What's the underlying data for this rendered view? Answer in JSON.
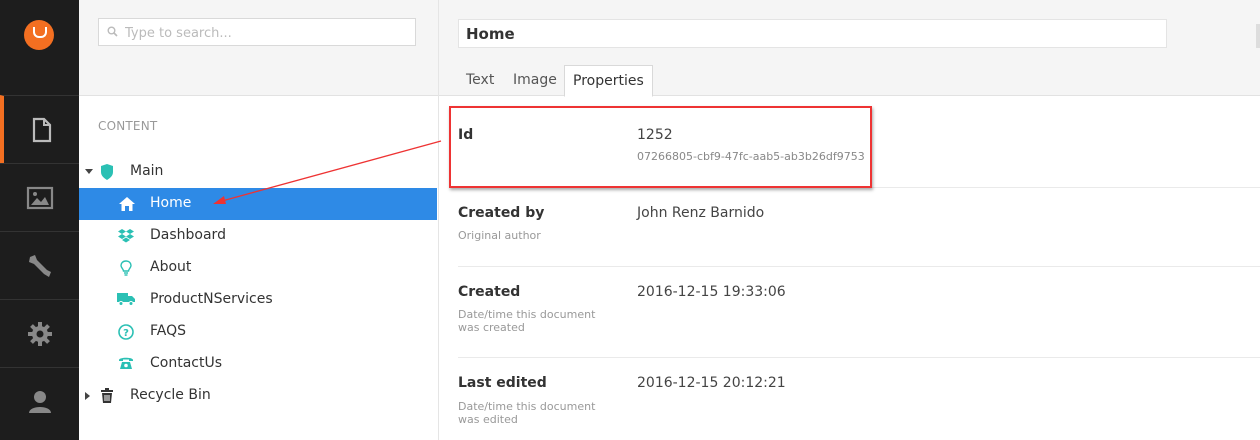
{
  "rail": {
    "logo": "umbraco-logo",
    "sections": [
      {
        "name": "content",
        "icon": "document-icon",
        "active": true
      },
      {
        "name": "media",
        "icon": "image-icon",
        "active": false
      },
      {
        "name": "developer",
        "icon": "wrench-icon",
        "active": false
      },
      {
        "name": "settings",
        "icon": "gear-icon",
        "active": false
      },
      {
        "name": "users",
        "icon": "user-icon",
        "active": false
      }
    ],
    "accent_color": "#f36f21"
  },
  "tree": {
    "search_placeholder": "Type to search...",
    "section_title": "CONTENT",
    "root": "Main",
    "items": [
      {
        "label": "Home",
        "icon": "home-icon",
        "selected": true
      },
      {
        "label": "Dashboard",
        "icon": "dropbox-icon"
      },
      {
        "label": "About",
        "icon": "lightbulb-icon"
      },
      {
        "label": "ProductNServices",
        "icon": "truck-icon"
      },
      {
        "label": "FAQS",
        "icon": "question-icon"
      },
      {
        "label": "ContactUs",
        "icon": "phone-icon"
      }
    ],
    "recycle_bin": "Recycle Bin",
    "selected_color": "#2e8ae6",
    "icon_color": "#2bc0b4"
  },
  "editor": {
    "name": "Home",
    "tabs": [
      "Text",
      "Image",
      "Properties"
    ],
    "active_tab": "Properties",
    "properties": {
      "id": {
        "label": "Id",
        "value": "1252",
        "guid": "07266805-cbf9-47fc-aab5-ab3b26df9753"
      },
      "created_by": {
        "label": "Created by",
        "desc": "Original author",
        "value": "John Renz Barnido"
      },
      "created": {
        "label": "Created",
        "desc": "Date/time this document was created",
        "value": "2016-12-15 19:33:06"
      },
      "last_edited": {
        "label": "Last edited",
        "desc": "Date/time this document was edited",
        "value": "2016-12-15 20:12:21"
      }
    }
  },
  "annotation_color": "#e33333"
}
